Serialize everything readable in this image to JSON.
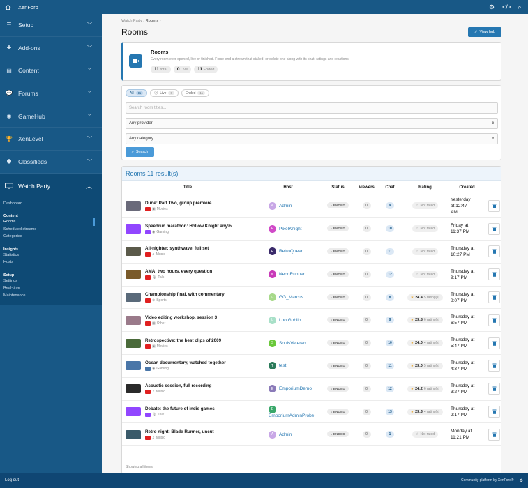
{
  "topbar": {
    "brand": "XenForo"
  },
  "sidebar": {
    "sections": [
      {
        "label": "Setup",
        "icon": "sliders-icon"
      },
      {
        "label": "Add-ons",
        "icon": "puzzle-icon"
      },
      {
        "label": "Content",
        "icon": "content-icon"
      },
      {
        "label": "Forums",
        "icon": "forums-icon"
      },
      {
        "label": "GameHub",
        "icon": "gamepad-icon"
      },
      {
        "label": "XenLevel",
        "icon": "trophy-icon"
      },
      {
        "label": "Classifieds",
        "icon": "tag-icon"
      }
    ],
    "open_section": "Watch Party",
    "links": {
      "dashboard": "Dashboard",
      "content_group": "Content",
      "rooms": "Rooms",
      "scheduled": "Scheduled streams",
      "categories": "Categories",
      "insights_group": "Insights",
      "statistics": "Statistics",
      "hosts": "Hosts",
      "setup_group": "Setup",
      "settings": "Settings",
      "realtime": "Real-time",
      "maintenance": "Maintenance"
    }
  },
  "breadcrumb": {
    "root": "Watch Party",
    "current": "Rooms"
  },
  "page": {
    "title": "Rooms",
    "view_hub": "View hub"
  },
  "intro": {
    "heading": "Rooms",
    "desc": "Every room ever opened, live or finished. Force-end a stream that stalled, or delete one along with its chat, ratings and reactions.",
    "total_n": "11",
    "total_l": "total",
    "live_n": "0",
    "live_l": "Live",
    "ended_n": "11",
    "ended_l": "Ended"
  },
  "filters": {
    "tab_all": "All",
    "tab_all_n": "11",
    "tab_live": "Live",
    "tab_live_n": "0",
    "tab_ended": "Ended",
    "tab_ended_n": "11",
    "search_placeholder": "Search room titles...",
    "provider": "Any provider",
    "category": "Any category",
    "search_button": "Search"
  },
  "results": {
    "heading": "Rooms 11 result(s)",
    "columns": {
      "title": "Title",
      "host": "Host",
      "status": "Status",
      "viewers": "Viewers",
      "chat": "Chat",
      "rating": "Rating",
      "created": "Created"
    },
    "footer": "Showing all items",
    "rows": [
      {
        "title": "Dune: Part Two, group premiere",
        "provider": "youtube",
        "category": "Movies",
        "cat_icon": "film-icon",
        "host": "Admin",
        "initial": "A",
        "avatar": "#c8a7e6",
        "status": "ENDED",
        "viewers": "0",
        "chat": "9",
        "rating": "Not rated",
        "created1": "Yesterday",
        "created2": "at 12:47",
        "created3": "AM",
        "thumb": "#6a6a7a"
      },
      {
        "title": "Speedrun marathon: Hollow Knight any%",
        "provider": "twitch",
        "category": "Gaming",
        "cat_icon": "gamepad-icon",
        "host": "PixelKnight",
        "initial": "P",
        "avatar": "#d04ac8",
        "status": "ENDED",
        "viewers": "0",
        "chat": "10",
        "rating": "Not rated",
        "created1": "Friday at",
        "created2": "11:37 PM",
        "created3": "",
        "thumb": "#9146ff"
      },
      {
        "title": "All-nighter: synthwave, full set",
        "provider": "youtube",
        "category": "Music",
        "cat_icon": "music-icon",
        "host": "RetroQueen",
        "initial": "R",
        "avatar": "#3a2a6a",
        "status": "ENDED",
        "viewers": "0",
        "chat": "11",
        "rating": "Not rated",
        "created1": "Thursday at",
        "created2": "10:27 PM",
        "created3": "",
        "thumb": "#5b5a4a"
      },
      {
        "title": "AMA: two hours, every question",
        "provider": "youtube",
        "category": "Talk",
        "cat_icon": "mic-icon",
        "host": "NeonRunner",
        "initial": "N",
        "avatar": "#c83ab8",
        "status": "ENDED",
        "viewers": "0",
        "chat": "12",
        "rating": "Not rated",
        "created1": "Thursday at",
        "created2": "9:17 PM",
        "created3": "",
        "thumb": "#7a5a2a"
      },
      {
        "title": "Championship final, with commentary",
        "provider": "youtube",
        "category": "Sports",
        "cat_icon": "ball-icon",
        "host": "GG_Marcus",
        "initial": "G",
        "avatar": "#a7d98a",
        "status": "ENDED",
        "viewers": "0",
        "chat": "8",
        "rating": "24.4",
        "rating_n": "5 rating(s)",
        "created1": "Thursday at",
        "created2": "8:07 PM",
        "created3": "",
        "thumb": "#5a6a7a"
      },
      {
        "title": "Video editing workshop, session 3",
        "provider": "youtube",
        "category": "Other",
        "cat_icon": "grid-icon",
        "host": "LootGoblin",
        "initial": "L",
        "avatar": "#a8e0c8",
        "status": "ENDED",
        "viewers": "0",
        "chat": "9",
        "rating": "23.8",
        "rating_n": "6 rating(s)",
        "created1": "Thursday at",
        "created2": "6:57 PM",
        "created3": "",
        "thumb": "#9a7a8a"
      },
      {
        "title": "Retrospective: the best clips of 2009",
        "provider": "youtube",
        "category": "Movies",
        "cat_icon": "film-icon",
        "host": "SoulsVeteran",
        "initial": "S",
        "avatar": "#6ac83a",
        "status": "ENDED",
        "viewers": "0",
        "chat": "10",
        "rating": "24.0",
        "rating_n": "4 rating(s)",
        "created1": "Thursday at",
        "created2": "5:47 PM",
        "created3": "",
        "thumb": "#4a6a3a"
      },
      {
        "title": "Ocean documentary, watched together",
        "provider": "vk",
        "category": "Gaming",
        "cat_icon": "gamepad-icon",
        "host": "test",
        "initial": "T",
        "avatar": "#2a7a5a",
        "status": "ENDED",
        "viewers": "0",
        "chat": "11",
        "rating": "23.0",
        "rating_n": "5 rating(s)",
        "created1": "Thursday at",
        "created2": "4:37 PM",
        "created3": "",
        "thumb": "#4a76a8"
      },
      {
        "title": "Acoustic session, full recording",
        "provider": "youtube",
        "category": "Music",
        "cat_icon": "music-icon",
        "host": "EmporiumDemo",
        "initial": "E",
        "avatar": "#8a7ab8",
        "status": "ENDED",
        "viewers": "0",
        "chat": "12",
        "rating": "24.2",
        "rating_n": "6 rating(s)",
        "created1": "Thursday at",
        "created2": "3:27 PM",
        "created3": "",
        "thumb": "#2a2a2a"
      },
      {
        "title": "Debate: the future of indie games",
        "provider": "twitch",
        "category": "Talk",
        "cat_icon": "mic-icon",
        "host": "EmporiumAdminProbe",
        "initial": "E",
        "avatar": "#3aa86a",
        "status": "ENDED",
        "viewers": "0",
        "chat": "13",
        "rating": "23.3",
        "rating_n": "4 rating(s)",
        "created1": "Thursday at",
        "created2": "2:17 PM",
        "created3": "",
        "thumb": "#9146ff"
      },
      {
        "title": "Retro night: Blade Runner, uncut",
        "provider": "youtube",
        "category": "Music",
        "cat_icon": "music-icon",
        "host": "Admin",
        "initial": "A",
        "avatar": "#c8a7e6",
        "status": "ENDED",
        "viewers": "0",
        "chat": "1",
        "rating": "Not rated",
        "created1": "Monday at",
        "created2": "11:21 PM",
        "created3": "",
        "thumb": "#3a5a6a"
      }
    ]
  },
  "footer": {
    "logout": "Log out",
    "copyright": "Community platform by XenForo®"
  },
  "colors": {
    "primary": "#185886",
    "accent": "#2577b1",
    "youtube": "#e02020",
    "twitch": "#9146ff",
    "star": "#e5a42d"
  }
}
